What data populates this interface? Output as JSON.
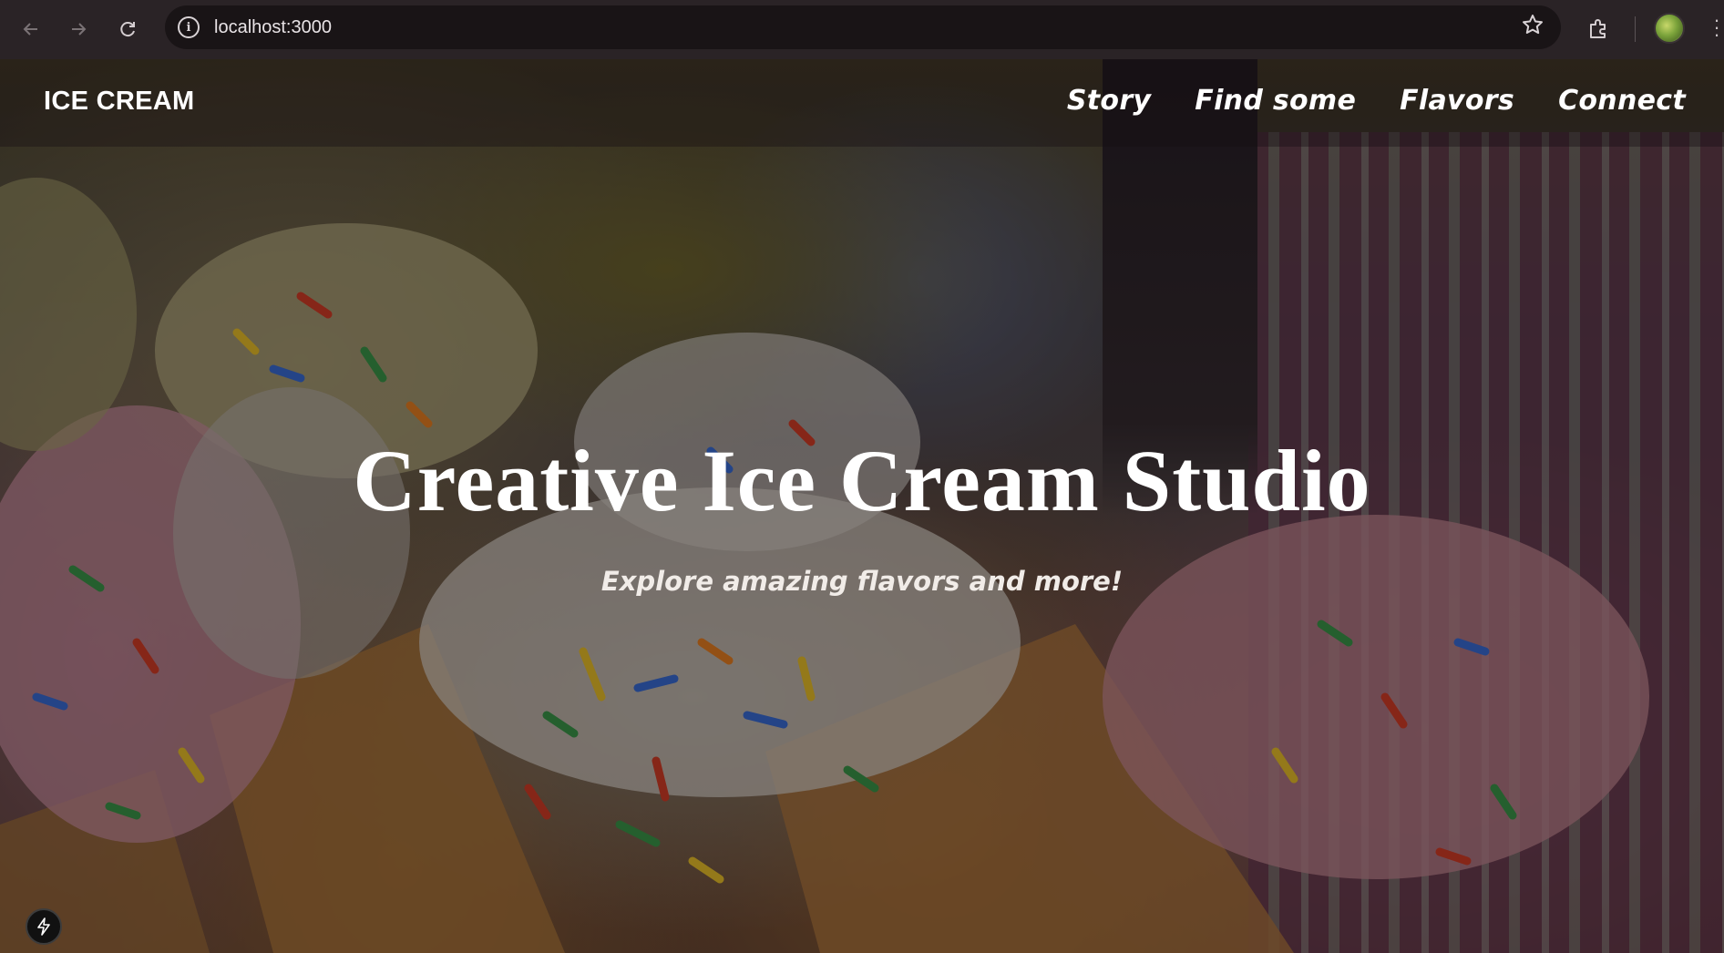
{
  "browser": {
    "url": "localhost:3000",
    "icons": {
      "back": "back-arrow-icon",
      "forward": "forward-arrow-icon",
      "reload": "reload-icon",
      "site_info": "info-icon",
      "bookmark": "star-icon",
      "extensions": "puzzle-icon",
      "profile": "avatar",
      "menu": "kebab-menu-icon"
    }
  },
  "site": {
    "logo": "ICE CREAM",
    "nav": [
      "Story",
      "Find some",
      "Flavors",
      "Connect"
    ]
  },
  "hero": {
    "title": "Creative Ice Cream Studio",
    "subtitle": "Explore amazing flavors and more!"
  },
  "colors": {
    "text": "#ffffff",
    "chrome_bg": "#2a2326",
    "omnibox_bg": "#191416"
  }
}
